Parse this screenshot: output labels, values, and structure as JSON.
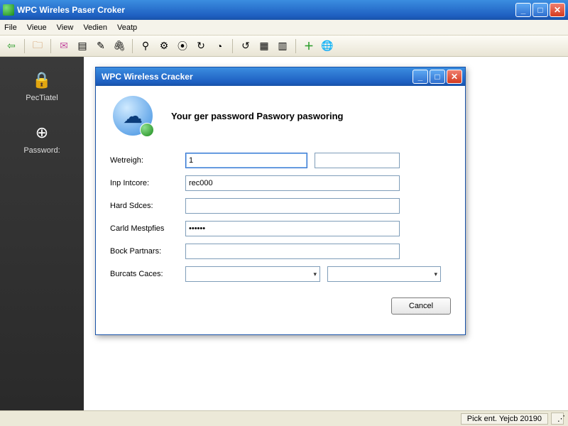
{
  "window": {
    "title": "WPC Wireles Paser Croker"
  },
  "menu": {
    "file": "File",
    "vieue": "Vieue",
    "view": "View",
    "vedien": "Vedien",
    "veatp": "Veatp"
  },
  "toolbar": {
    "back": "⇦",
    "folder": "🗀",
    "mail": "✉",
    "save": "▤",
    "edit": "✎",
    "attach": "🖇",
    "person": "⚲",
    "run": "⚙",
    "globe2": "⦿",
    "refresh": "↻",
    "clock": "◔",
    "cycle": "↺",
    "grid1": "▦",
    "grid2": "▥",
    "plus": "＋",
    "world": "🌐"
  },
  "sidebar": {
    "items": [
      {
        "label": "PecTiatel",
        "icon": "🔒"
      },
      {
        "label": "Password:",
        "icon": "⊕"
      }
    ]
  },
  "dialog": {
    "title": "WPC Wireless Cracker",
    "heading": "Your ger password Paswory pasworing",
    "fields": {
      "wetreigh": {
        "label": "Wetreigh:",
        "value": "1"
      },
      "inp": {
        "label": "Inp Intcore:",
        "value": "rec000"
      },
      "hard": {
        "label": "Hard Sdces:",
        "value": ""
      },
      "carld": {
        "label": "Carld Mestpfies",
        "value": "••••••"
      },
      "bock": {
        "label": "Bock Partnars:",
        "value": ""
      },
      "burcats": {
        "label": "Burcats Caces:"
      }
    },
    "cancel": "Cancel"
  },
  "status": {
    "text": "Pick ent. Yejcb 20190"
  }
}
